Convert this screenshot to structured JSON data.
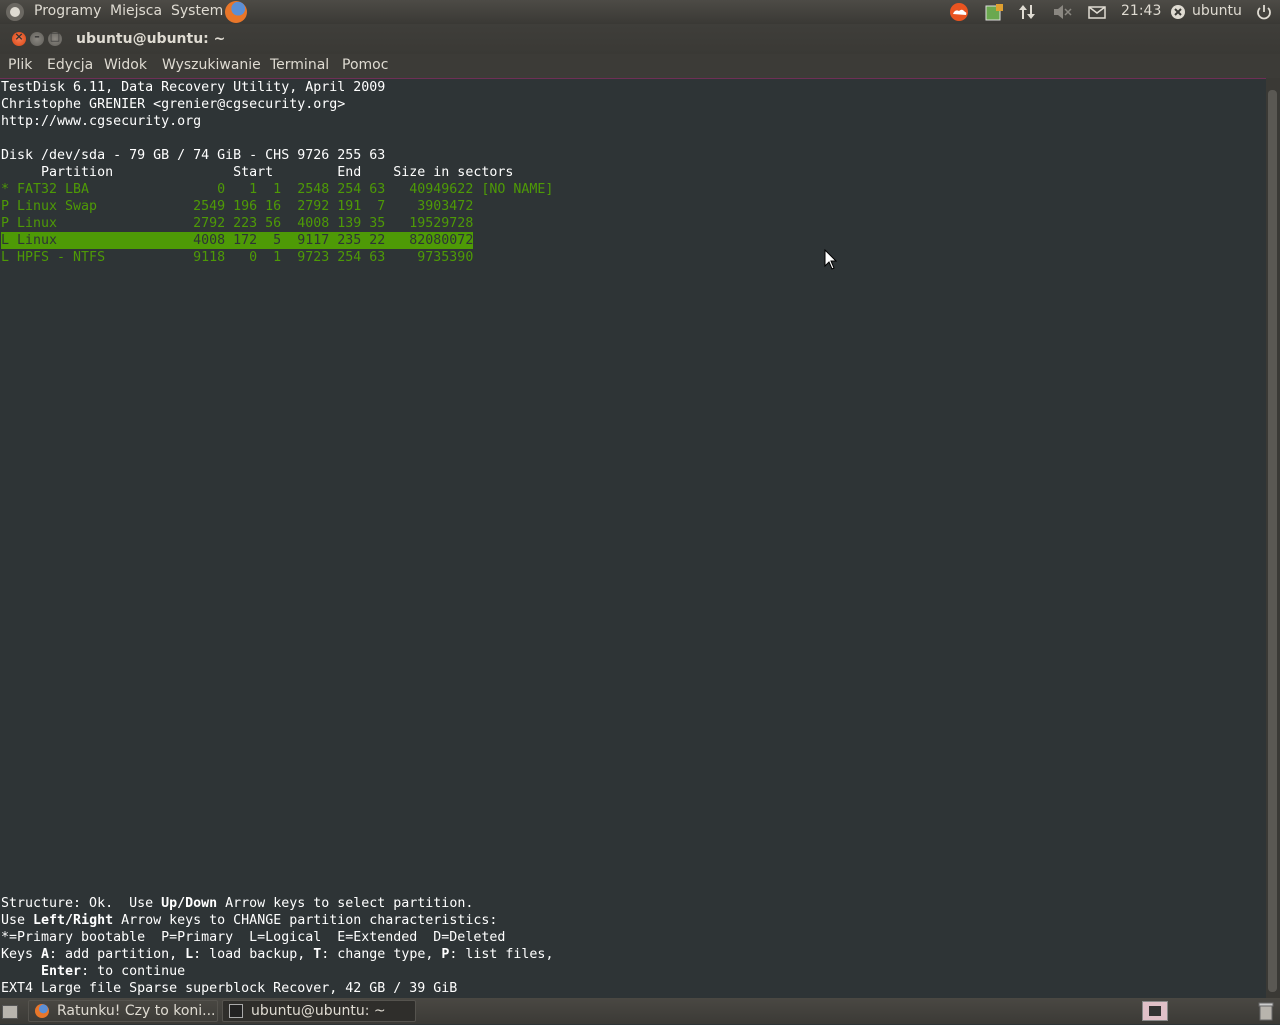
{
  "top_panel": {
    "menus": [
      "Programy",
      "Miejsca",
      "System"
    ],
    "clock": "21:43",
    "user": "ubuntu"
  },
  "window": {
    "title": "ubuntu@ubuntu: ~"
  },
  "menubar": [
    "Plik",
    "Edycja",
    "Widok",
    "Wyszukiwanie",
    "Terminal",
    "Pomoc"
  ],
  "terminal": {
    "header": [
      "TestDisk 6.11, Data Recovery Utility, April 2009",
      "Christophe GRENIER <grenier@cgsecurity.org>",
      "http://www.cgsecurity.org"
    ],
    "disk_line": "Disk /dev/sda - 79 GB / 74 GiB - CHS 9726 255 63",
    "columns_line": "     Partition               Start        End    Size in sectors",
    "partitions": [
      "* FAT32 LBA                0   1  1  2548 254 63   40949622 [NO NAME]",
      "P Linux Swap            2549 196 16  2792 191  7    3903472",
      "P Linux                 2792 223 56  4008 139 35   19529728",
      "L Linux                 4008 172  5  9117 235 22   82080072",
      "L HPFS - NTFS           9118   0  1  9723 254 63    9735390"
    ],
    "selected_index": 3,
    "footer": {
      "l1_a": "Structure: Ok.  Use ",
      "l1_b": "Up/Down",
      "l1_c": " Arrow keys to select partition.",
      "l2_a": "Use ",
      "l2_b": "Left/Right",
      "l2_c": " Arrow keys to CHANGE partition characteristics:",
      "l3": "*=Primary bootable  P=Primary  L=Logical  E=Extended  D=Deleted",
      "l4_a": "Keys ",
      "l4_b": "A",
      "l4_c": ": add partition, ",
      "l4_d": "L",
      "l4_e": ": load backup, ",
      "l4_f": "T",
      "l4_g": ": change type, ",
      "l4_h": "P",
      "l4_i": ": list files,",
      "l5_a": "     ",
      "l5_b": "Enter",
      "l5_c": ": to continue",
      "l6": "EXT4 Large file Sparse superblock Recover, 42 GB / 39 GiB"
    }
  },
  "taskbar": {
    "tasks": [
      "Ratunku! Czy to koni...",
      "ubuntu@ubuntu: ~"
    ]
  },
  "colors": {
    "terminal_bg": "#2e3436",
    "terminal_green": "#4e9a06",
    "panel_bg": "#3c3b37"
  }
}
